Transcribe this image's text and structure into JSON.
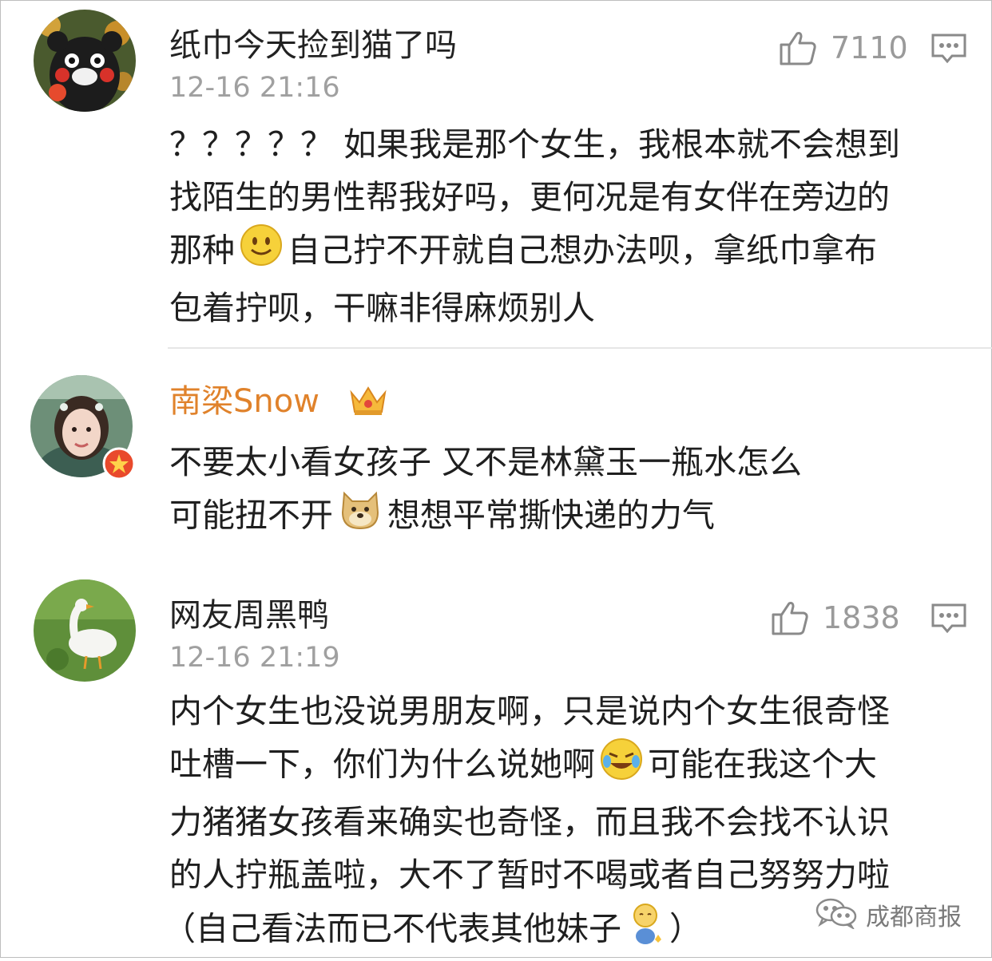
{
  "comments": [
    {
      "username": "纸巾今天捡到猫了吗",
      "timestamp": "12-16 21:16",
      "likes": "7110",
      "lines": [
        "？？？？？ 如果我是那个女生，我根本就不会想到",
        "找陌生的男性帮我好吗，更何况是有女伴在旁边的",
        [
          "那种",
          "自己拧不开就自己想办法呗，拿纸巾拿布"
        ],
        "包着拧呗，干嘛非得麻烦别人"
      ]
    },
    {
      "username": "南梁Snow",
      "lines": [
        "不要太小看女孩子 又不是林黛玉一瓶水怎么",
        [
          "可能扭不开",
          "想想平常撕快递的力气"
        ]
      ]
    },
    {
      "username": "网友周黑鸭",
      "timestamp": "12-16 21:19",
      "likes": "1838",
      "lines": [
        "内个女生也没说男朋友啊，只是说内个女生很奇怪",
        [
          "吐槽一下，你们为什么说她啊",
          "可能在我这个大"
        ],
        "力猪猪女孩看来确实也奇怪，而且我不会找不认识",
        "的人拧瓶盖啦，大不了暂时不喝或者自己努努力啦",
        [
          "（自己看法而已不代表其他妹子",
          "）"
        ]
      ]
    }
  ],
  "watermark": "成都商报",
  "icons": {
    "like": "thumbs-up-icon",
    "reply": "comment-icon",
    "smile": "smile-emoji-icon",
    "doge": "doge-emoji-icon",
    "laugh": "laugh-cry-emoji-icon",
    "shy": "shy-emoji-icon",
    "crown": "crown-icon",
    "verified": "verified-badge-icon",
    "wechat": "wechat-logo-icon"
  },
  "colors": {
    "username": "#222222",
    "vip_username": "#e0822b",
    "meta": "#a0a0a0"
  }
}
